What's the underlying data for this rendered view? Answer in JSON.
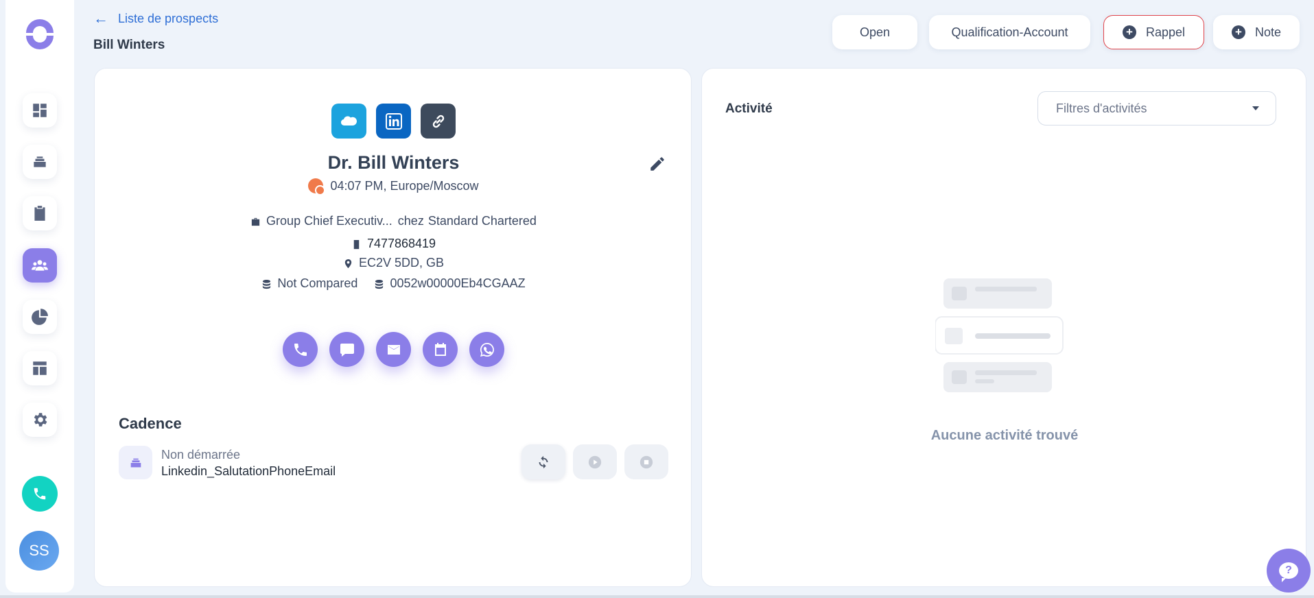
{
  "header": {
    "back_label": "Liste de prospects",
    "page_title": "Bill Winters",
    "buttons": {
      "open": "Open",
      "qualification": "Qualification-Account",
      "rappel": "Rappel",
      "note": "Note"
    }
  },
  "sidebar": {
    "items": [
      {
        "icon": "dashboard-icon"
      },
      {
        "icon": "stack-icon"
      },
      {
        "icon": "clipboard-icon"
      },
      {
        "icon": "people-icon",
        "active": true
      },
      {
        "icon": "pie-chart-icon"
      },
      {
        "icon": "layout-icon"
      },
      {
        "icon": "settings-icon"
      }
    ],
    "avatar_initials": "SS"
  },
  "contact": {
    "name": "Dr. Bill Winters",
    "local_time": "04:07 PM, Europe/Moscow",
    "job_title": "Group Chief Executiv...",
    "job_connector": "chez",
    "company": "Standard Chartered",
    "phone": "7477868419",
    "location": "EC2V 5DD, GB",
    "comparison_status": "Not Compared",
    "crm_id": "0052w00000Eb4CGAAZ"
  },
  "cadence": {
    "title": "Cadence",
    "status": "Non démarrée",
    "name": "Linkedin_SalutationPhoneEmail"
  },
  "activity": {
    "title": "Activité",
    "filter_placeholder": "Filtres d'activités",
    "empty_message": "Aucune activité trouvé"
  },
  "colors": {
    "accent": "#8b7ee8",
    "link": "#2f6fd6",
    "phone_fab": "#12d3c2",
    "rappel_border": "#e0434a"
  }
}
